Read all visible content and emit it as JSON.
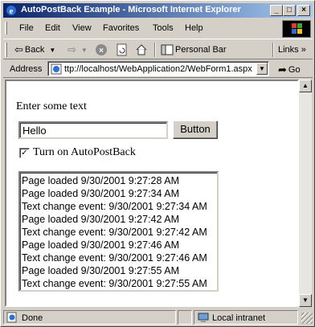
{
  "window": {
    "title": "AutoPostBack Example - Microsoft Internet Explorer"
  },
  "menubar": {
    "items": [
      "File",
      "Edit",
      "View",
      "Favorites",
      "Tools",
      "Help"
    ]
  },
  "toolbar": {
    "back_label": "Back",
    "personal_bar_label": "Personal Bar",
    "links_label": "Links"
  },
  "addressbar": {
    "label": "Address",
    "url": "ttp://localhost/WebApplication2/WebForm1.aspx",
    "go_label": "Go"
  },
  "page": {
    "prompt": "Enter some text",
    "text_value": "Hello",
    "button_label": "Button",
    "checkbox_label": "Turn on AutoPostBack",
    "checkbox_checked": true,
    "log": [
      "Page loaded 9/30/2001 9:27:28 AM",
      "Page loaded 9/30/2001 9:27:34 AM",
      "Text change event: 9/30/2001 9:27:34 AM",
      "Page loaded 9/30/2001 9:27:42 AM",
      "Text change event: 9/30/2001 9:27:42 AM",
      "Page loaded 9/30/2001 9:27:46 AM",
      "Text change event: 9/30/2001 9:27:46 AM",
      "Page loaded 9/30/2001 9:27:55 AM",
      "Text change event: 9/30/2001 9:27:55 AM"
    ]
  },
  "statusbar": {
    "status": "Done",
    "zone": "Local intranet"
  },
  "colors": {
    "titlebar_start": "#0a246a",
    "titlebar_end": "#a6caf0",
    "chrome": "#d4d0c8"
  }
}
